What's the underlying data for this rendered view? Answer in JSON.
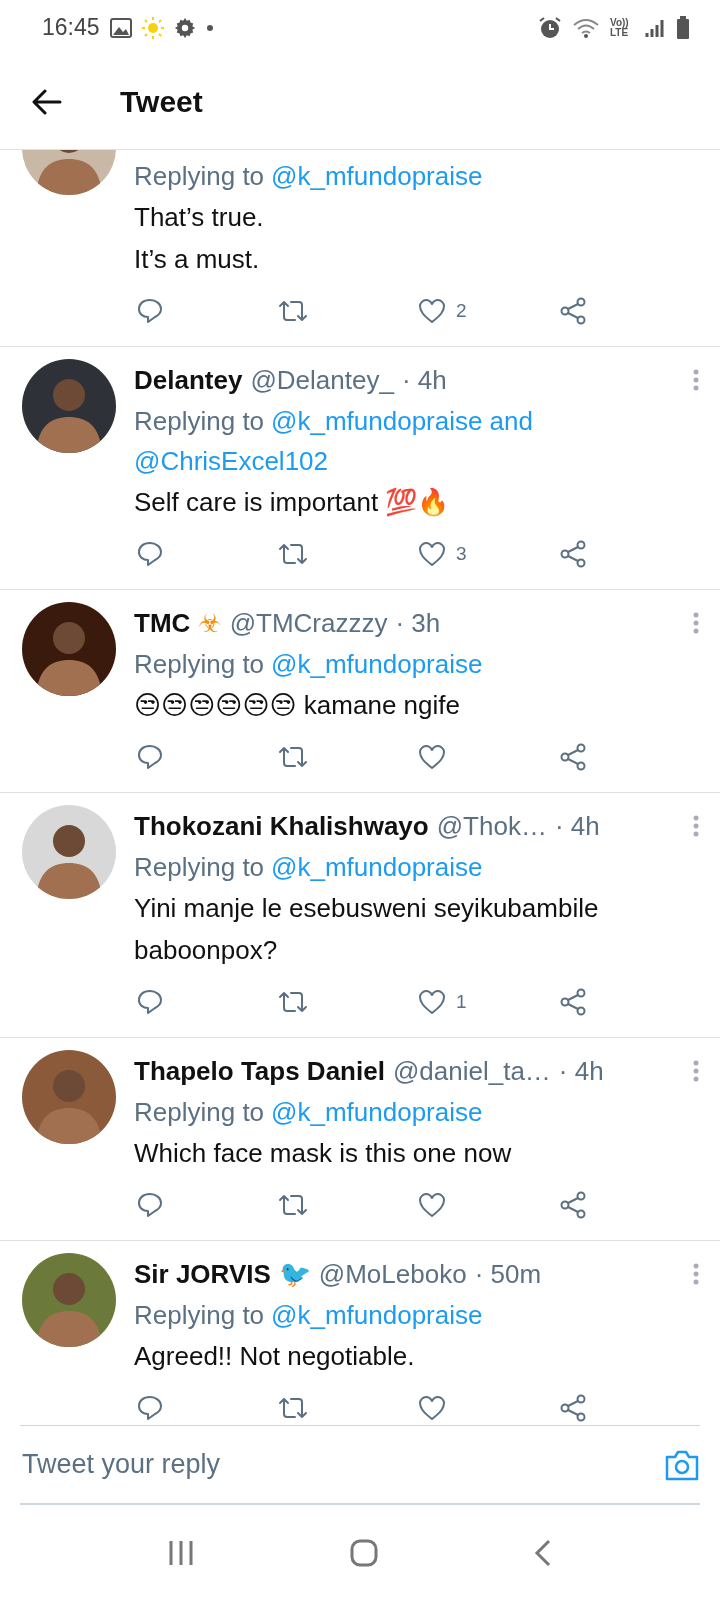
{
  "status_bar": {
    "time": "16:45",
    "network": "Vo)) LTE"
  },
  "header": {
    "title": "Tweet"
  },
  "tweets": [
    {
      "replying_prefix": "Replying to",
      "mentions": [
        "@k_mfundopraise"
      ],
      "body_lines": [
        "That’s true.",
        "It’s a must."
      ],
      "likes": "2"
    },
    {
      "name": "Delantey",
      "handle": "@Delantey_",
      "time": "· 4h",
      "replying_prefix": "Replying to",
      "mentions": [
        "@k_mfundopraise",
        "@ChrisExcel102"
      ],
      "conjunction": "and",
      "body_lines": [
        "Self care is important 💯🔥"
      ],
      "likes": "3"
    },
    {
      "name": "TMC",
      "badge": "☣",
      "handle": "@TMCrazzzy",
      "time": "· 3h",
      "replying_prefix": "Replying to",
      "mentions": [
        "@k_mfundopraise"
      ],
      "body_lines": [
        "😒😒😒😒😒😒 kamane ngife"
      ]
    },
    {
      "name": "Thokozani Khalishwayo",
      "handle": "@Thok…",
      "time": "· 4h",
      "replying_prefix": "Replying to",
      "mentions": [
        "@k_mfundopraise"
      ],
      "body_lines": [
        "Yini manje le esebusweni seyikubambile baboonpox?"
      ],
      "likes": "1"
    },
    {
      "name": "Thapelo Taps Daniel",
      "handle": "@daniel_ta…",
      "time": "· 4h",
      "replying_prefix": "Replying to",
      "mentions": [
        "@k_mfundopraise"
      ],
      "body_lines": [
        "Which face mask is this one now"
      ]
    },
    {
      "name": "Sir JORVIS",
      "badge": "🐦",
      "handle": "@MoLeboko",
      "time": "· 50m",
      "replying_prefix": "Replying to",
      "mentions": [
        "@k_mfundopraise"
      ],
      "body_lines": [
        "Agreed!! Not negotiable."
      ]
    }
  ],
  "reply_bar": {
    "placeholder": "Tweet your reply"
  }
}
